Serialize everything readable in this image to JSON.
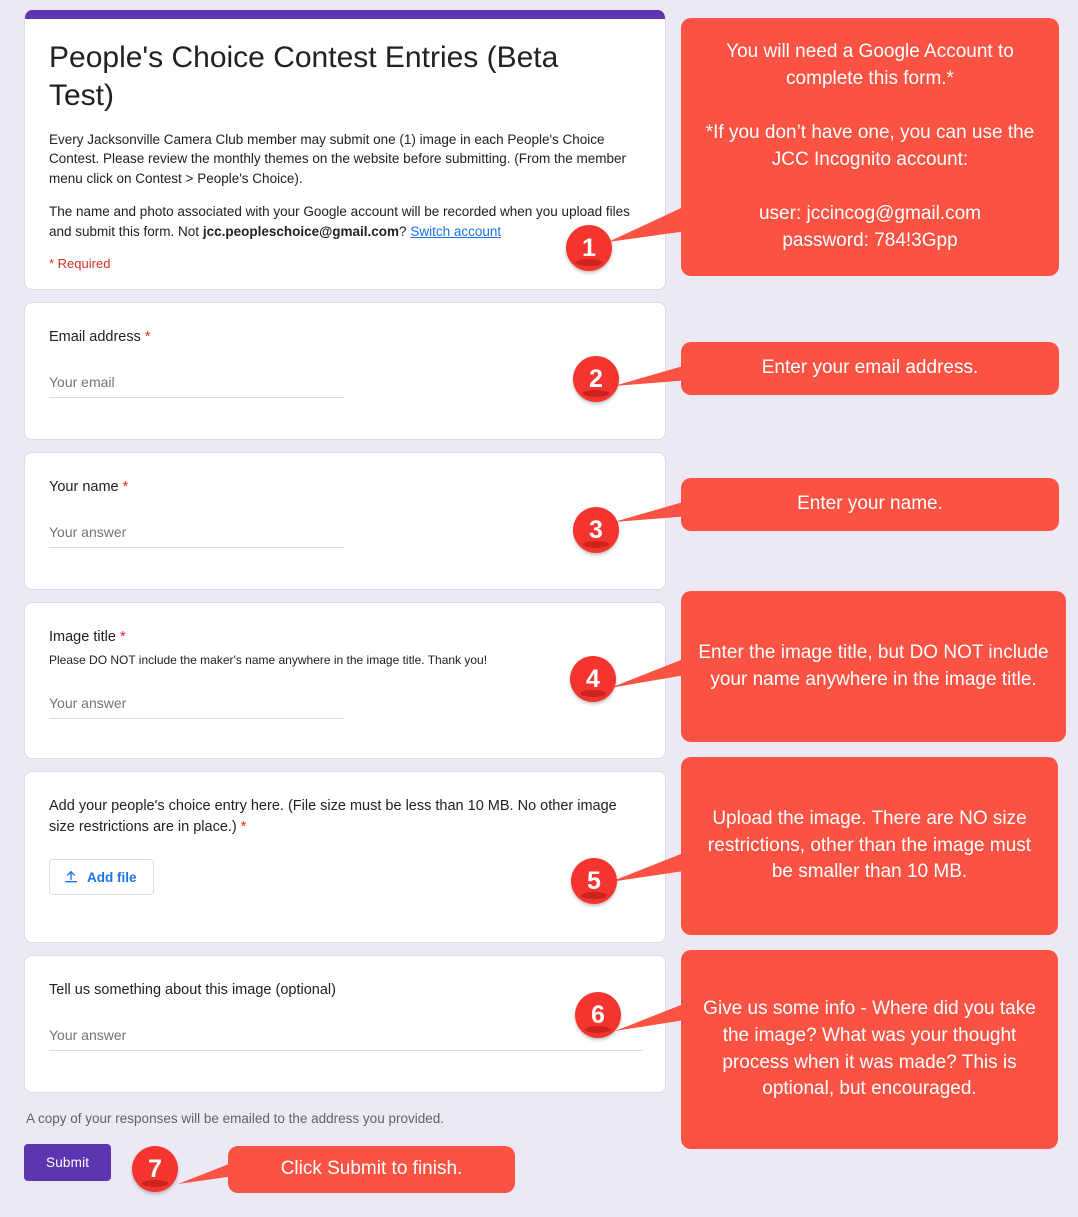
{
  "colors": {
    "page_background": "#ece9f5",
    "header_bar_purple": "#5e35b1",
    "callout_red": "#fb5343",
    "badge_red": "#f4352f",
    "link_blue": "#1a73e8",
    "required_red": "#d93025"
  },
  "form": {
    "title": "People's Choice Contest Entries (Beta Test)",
    "description_1": "Every Jacksonville Camera Club member may submit one (1) image in each People's Choice Contest.  Please review the monthly themes on the website before submitting. (From the member menu click on Contest > People's Choice).",
    "description_2_prefix": "The name and photo associated with your Google account will be recorded when you upload files and submit this form. Not ",
    "account_email": "jcc.peopleschoice@gmail.com",
    "description_2_suffix": "? ",
    "switch_account_link": "Switch account",
    "required_note": "* Required",
    "footer_note": "A copy of your responses will be emailed to the address you provided.",
    "submit_label": "Submit"
  },
  "questions": [
    {
      "id": "email",
      "label": "Email address",
      "required_marker": "*",
      "help": "",
      "placeholder": "Your email"
    },
    {
      "id": "name",
      "label": "Your name",
      "required_marker": "*",
      "help": "",
      "placeholder": "Your answer"
    },
    {
      "id": "image-title",
      "label": "Image title",
      "required_marker": "*",
      "help": "Please DO NOT include the maker's name anywhere in the image title. Thank you!",
      "placeholder": "Your answer"
    },
    {
      "id": "file-upload",
      "label": "Add your people's choice entry here. (File size must be less than 10 MB. No other image size restrictions are in place.)",
      "required_marker": "*",
      "help": "",
      "add_file_label": "Add file",
      "add_file_icon": "upload-icon"
    },
    {
      "id": "about-image",
      "label": "Tell us something about this image (optional)",
      "required_marker": "",
      "help": "",
      "placeholder": "Your answer"
    }
  ],
  "callouts": [
    {
      "number": "1",
      "text": "You will need a Google Account to complete this form.*\n\n*If you don’t have one, you can use the JCC Incognito account:\n\nuser: jccincog@gmail.com\npassword: 784!3Gpp"
    },
    {
      "number": "2",
      "text": "Enter your email address."
    },
    {
      "number": "3",
      "text": "Enter your name."
    },
    {
      "number": "4",
      "text": "Enter the image title, but DO NOT include your name anywhere in the image title."
    },
    {
      "number": "5",
      "text": "Upload the image.  There are NO size restrictions, other than the image must be smaller than 10 MB."
    },
    {
      "number": "6",
      "text": "Give us some info - Where did you take the image? What was your thought process when it was made? This is optional, but encouraged."
    },
    {
      "number": "7",
      "text": "Click Submit to finish."
    }
  ]
}
